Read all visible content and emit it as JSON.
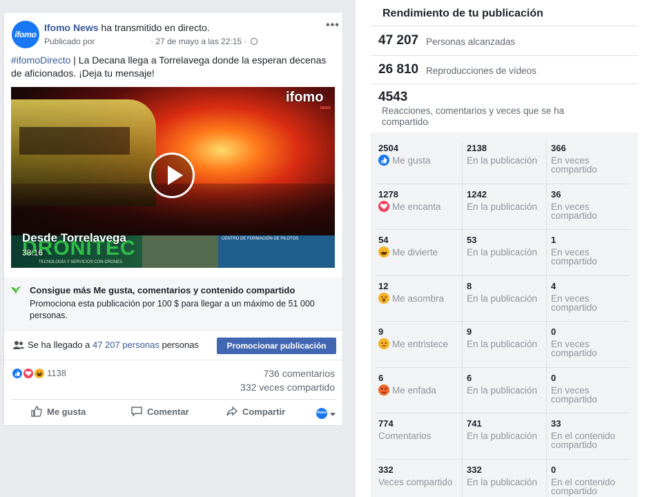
{
  "post": {
    "page_name": "Ifomo News",
    "action_text": " ha transmitido en directo.",
    "published_by": "Publicado por",
    "date": "· 27 de mayo a las 22:15 ·",
    "avatar_text": "ifomo",
    "hashtag": "#ifomoDirecto",
    "text": " | La Decana llega a Torrelavega donde la esperan decenas de aficionados. ¡Deja tu mensaje!",
    "video": {
      "logo": "ifomo",
      "logo_sub": "NEWS",
      "location": "Desde Torrelavega",
      "duration": "38:16",
      "ad_brand": "DRONITEC",
      "ad_tagline": "TECNOLOGÍA Y SERVICIOS CON DRONES",
      "ad_center": "CENTRO DE FORMACIÓN DE PILOTOS"
    },
    "promo": {
      "title": "Consigue más Me gusta, comentarios y contenido compartido",
      "text": "Promociona esta publicación por 100 $ para llegar a un máximo de 51 000 personas."
    },
    "reach": {
      "prefix": "Se ha llegado a ",
      "count": "47 207 personas",
      "suffix": " personas",
      "button": "Promocionar publicación"
    },
    "reactions_count": "1138",
    "comments": "736 comentarios",
    "shares": "332 veces compartido",
    "actions": {
      "like": "Me gusta",
      "comment": "Comentar",
      "share": "Compartir"
    },
    "colors": {
      "link": "#385898",
      "button": "#4267b2",
      "like": "#1877f2",
      "love": "#f33e58",
      "haha": "#f7b125"
    }
  },
  "panel": {
    "title": "Rendimiento de tu publicación",
    "reach_num": "47 207",
    "reach_lbl": "Personas alcanzadas",
    "views_num": "26 810",
    "views_lbl": "Reproducciones de vídeos",
    "engage_num": "4543",
    "engage_lbl_1": "Reacciones, comentarios y veces que se ha",
    "engage_lbl_2": "compartido",
    "rows": [
      {
        "total": "2504",
        "label": "Me gusta",
        "icon": "like-icon",
        "on_post": "2138",
        "on_post_lbl": "En la publicación",
        "shared": "366",
        "shared_lbl_1": "En veces",
        "shared_lbl_2": "compartido"
      },
      {
        "total": "1278",
        "label": "Me encanta",
        "icon": "love-icon",
        "on_post": "1242",
        "on_post_lbl": "En la publicación",
        "shared": "36",
        "shared_lbl_1": "En veces",
        "shared_lbl_2": "compartido"
      },
      {
        "total": "54",
        "label": "Me divierte",
        "icon": "haha-icon",
        "on_post": "53",
        "on_post_lbl": "En la publicación",
        "shared": "1",
        "shared_lbl_1": "En veces",
        "shared_lbl_2": "compartido"
      },
      {
        "total": "12",
        "label": "Me asombra",
        "icon": "wow-icon",
        "on_post": "8",
        "on_post_lbl": "En la publicación",
        "shared": "4",
        "shared_lbl_1": "En veces",
        "shared_lbl_2": "compartido"
      },
      {
        "total": "9",
        "label": "Me entristece",
        "icon": "sad-icon",
        "on_post": "9",
        "on_post_lbl": "En la publicación",
        "shared": "0",
        "shared_lbl_1": "En veces",
        "shared_lbl_2": "compartido"
      },
      {
        "total": "6",
        "label": "Me enfada",
        "icon": "angry-icon",
        "on_post": "6",
        "on_post_lbl": "En la publicación",
        "shared": "0",
        "shared_lbl_1": "En veces",
        "shared_lbl_2": "compartido"
      },
      {
        "total": "774",
        "label": "Comentarios",
        "icon": "",
        "on_post": "741",
        "on_post_lbl": "En la publicación",
        "shared": "33",
        "shared_lbl_1": "En el contenido",
        "shared_lbl_2": "compartido"
      },
      {
        "total": "332",
        "label": "Veces compartido",
        "icon": "",
        "on_post": "332",
        "on_post_lbl": "En la publicación",
        "shared": "0",
        "shared_lbl_1": "En el contenido",
        "shared_lbl_2": "compartido"
      }
    ]
  }
}
